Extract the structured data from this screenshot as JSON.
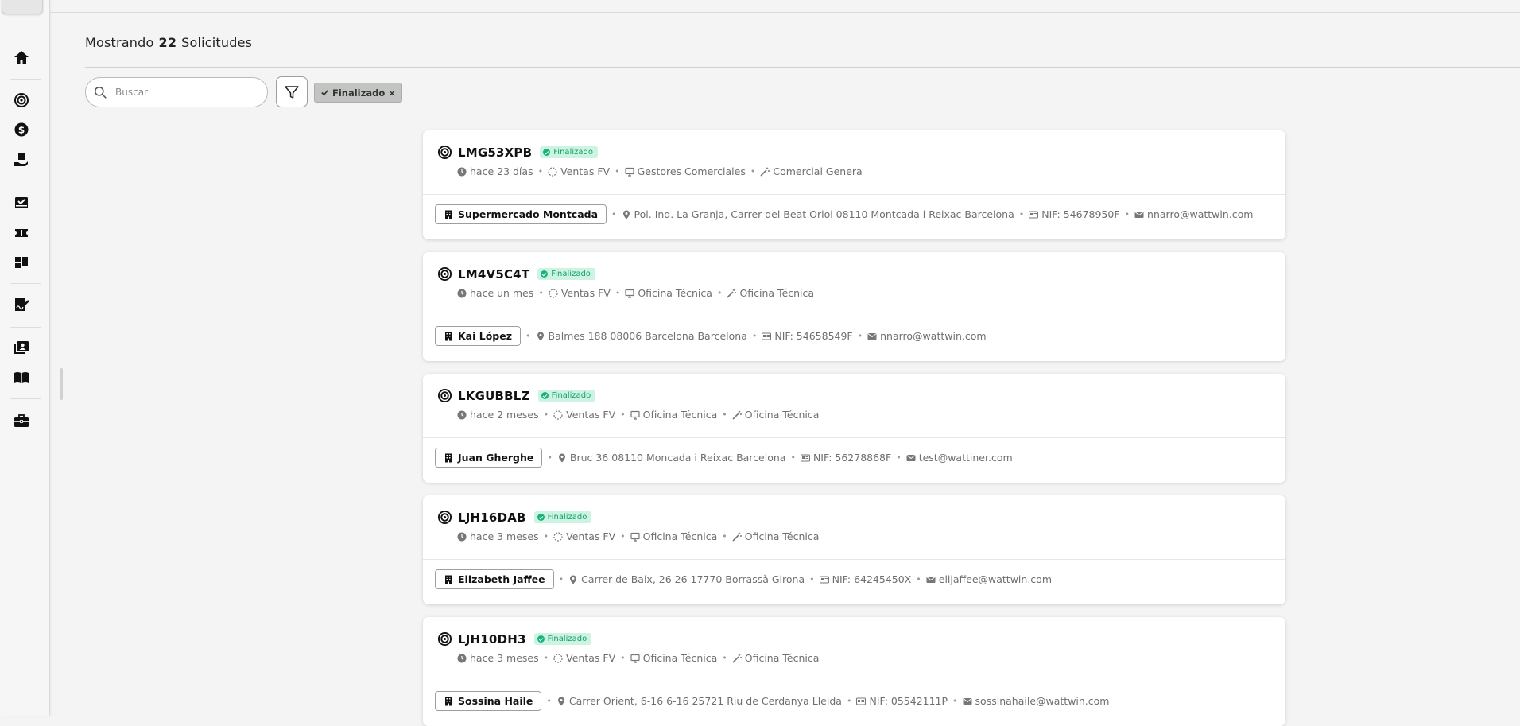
{
  "header": {
    "prefix": "Mostrando",
    "count": "22",
    "suffix": "Solicitudes"
  },
  "search": {
    "placeholder": "Buscar"
  },
  "filter_chip": {
    "label": "Finalizado",
    "remove": "×"
  },
  "colors": {
    "accent_green": "#18b37a",
    "badge_bg": "#cdf3e2"
  },
  "sidebar": {
    "icons": [
      "home-icon",
      "target-icon",
      "dollar-icon",
      "hand-box-icon",
      "inbox-check-icon",
      "ticket-icon",
      "dashboard-icon",
      "document-sign-icon",
      "contacts-icon",
      "book-icon",
      "briefcase-icon"
    ]
  },
  "cards": [
    {
      "code": "LMG53XPB",
      "status": "Finalizado",
      "time": "hace 23 días",
      "type": "Ventas FV",
      "team": "Gestores Comerciales",
      "role": "Comercial Genera",
      "client": "Supermercado Montcada",
      "address": "Pol. Ind. La Granja, Carrer del Beat Oriol 08110 Montcada i Reixac Barcelona",
      "nif": "NIF: 54678950F",
      "email": "nnarro@wattwin.com"
    },
    {
      "code": "LM4V5C4T",
      "status": "Finalizado",
      "time": "hace un mes",
      "type": "Ventas FV",
      "team": "Oficina Técnica",
      "role": "Oficina Técnica",
      "client": "Kai López",
      "address": "Balmes 188 08006 Barcelona Barcelona",
      "nif": "NIF: 54658549F",
      "email": "nnarro@wattwin.com"
    },
    {
      "code": "LKGUBBLZ",
      "status": "Finalizado",
      "time": "hace 2 meses",
      "type": "Ventas FV",
      "team": "Oficina Técnica",
      "role": "Oficina Técnica",
      "client": "Juan Gherghe",
      "address": "Bruc 36 08110 Moncada i Reixac Barcelona",
      "nif": "NIF: 56278868F",
      "email": "test@wattiner.com"
    },
    {
      "code": "LJH16DAB",
      "status": "Finalizado",
      "time": "hace 3 meses",
      "type": "Ventas FV",
      "team": "Oficina Técnica",
      "role": "Oficina Técnica",
      "client": "Elizabeth Jaffee",
      "address": "Carrer de Baix, 26 26 17770 Borrassà Girona",
      "nif": "NIF: 64245450X",
      "email": "elijaffee@wattwin.com"
    },
    {
      "code": "LJH10DH3",
      "status": "Finalizado",
      "time": "hace 3 meses",
      "type": "Ventas FV",
      "team": "Oficina Técnica",
      "role": "Oficina Técnica",
      "client": "Sossina Haile",
      "address": "Carrer Orient, 6-16 6-16 25721 Riu de Cerdanya Lleida",
      "nif": "NIF: 05542111P",
      "email": "sossinahaile@wattwin.com"
    }
  ]
}
